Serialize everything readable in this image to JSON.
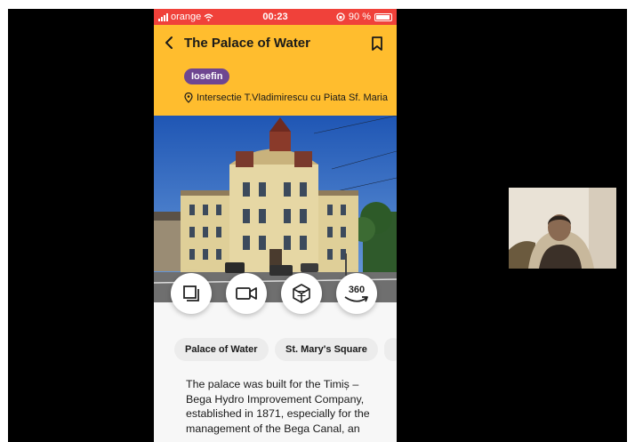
{
  "status_bar": {
    "carrier": "orange",
    "time": "00:23",
    "battery": "90 %"
  },
  "header": {
    "title": "The Palace of Water",
    "tag": "Iosefin",
    "address": "Intersectie T.Vladimirescu cu Piata Sf. Maria"
  },
  "actions": {
    "gallery_icon": "gallery-icon",
    "video_icon": "video-camera-icon",
    "model_icon": "3d-cube-icon",
    "panorama_label": "360"
  },
  "chips": [
    "Palace of Water",
    "St. Mary's Square"
  ],
  "description": "The palace was built for the Timiș – Bega Hydro Improvement Company, established in 1871, especially for the management of the Bega Canal, an",
  "colors": {
    "status_bar": "#f0413a",
    "header": "#ffbd2e",
    "tag": "#6e4691"
  }
}
